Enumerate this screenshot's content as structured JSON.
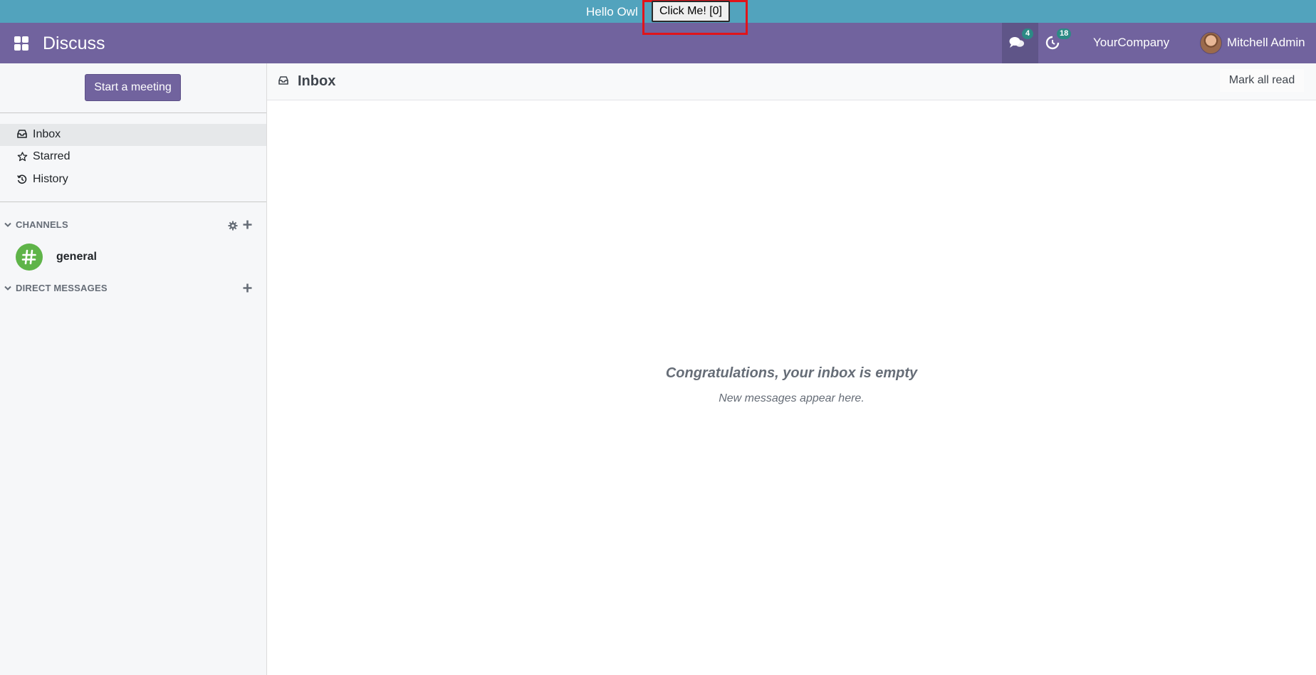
{
  "banner": {
    "text": "Hello Owl",
    "button_label": "Click Me! [0]"
  },
  "navbar": {
    "app_title": "Discuss",
    "chat_count": "4",
    "activity_count": "18",
    "company": "YourCompany",
    "user": "Mitchell Admin"
  },
  "sidebar": {
    "start_meeting_label": "Start a meeting",
    "mailboxes": [
      {
        "label": "Inbox",
        "icon": "inbox-icon"
      },
      {
        "label": "Starred",
        "icon": "star-icon"
      },
      {
        "label": "History",
        "icon": "history-icon"
      }
    ],
    "channels_title": "CHANNELS",
    "channels": [
      {
        "name": "general"
      }
    ],
    "direct_messages_title": "DIRECT MESSAGES"
  },
  "thread": {
    "title": "Inbox",
    "mark_all_read_label": "Mark all read",
    "empty_title": "Congratulations, your inbox is empty",
    "empty_subtitle": "New messages appear here."
  },
  "colors": {
    "banner": "#52a3bd",
    "navbar": "#71639e",
    "badge": "#2c8a85",
    "channel_avatar": "#5fb449",
    "highlight_frame": "#e1141a"
  }
}
